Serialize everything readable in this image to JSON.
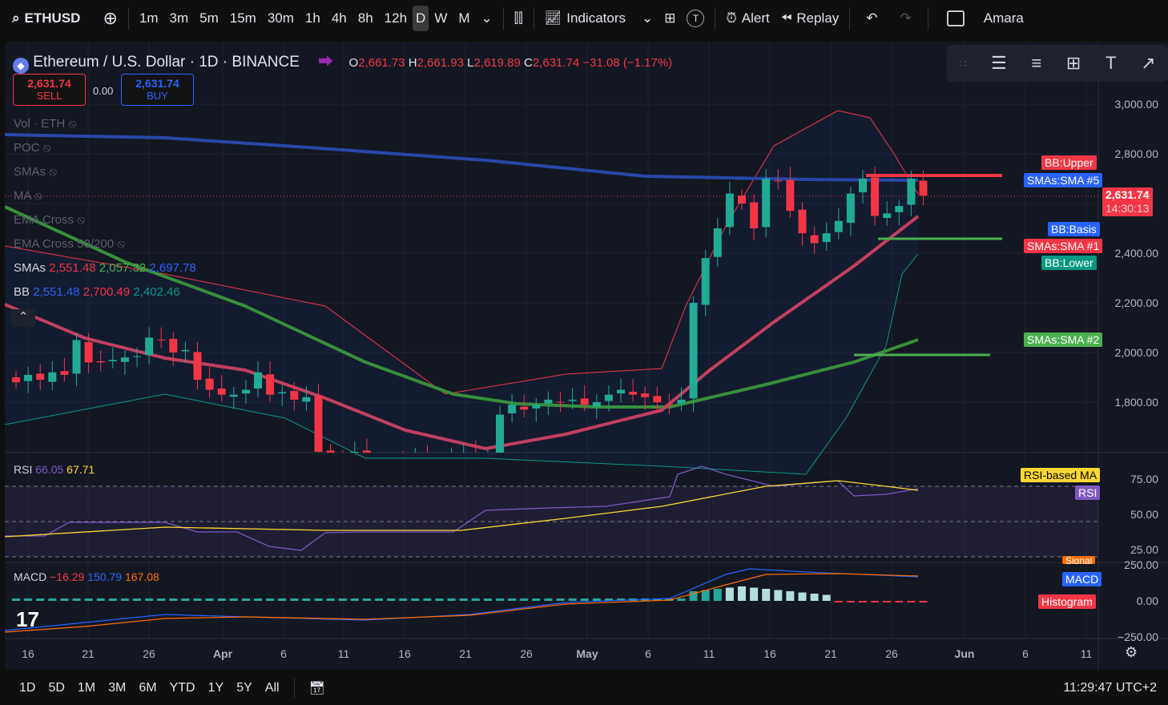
{
  "topbar": {
    "symbol": "ETHUSD",
    "intervals": [
      "1m",
      "3m",
      "5m",
      "15m",
      "30m",
      "1h",
      "4h",
      "8h",
      "12h",
      "D",
      "W",
      "M"
    ],
    "active_interval": "D",
    "indicators": "Indicators",
    "alert": "Alert",
    "replay": "Replay",
    "user": "Amara"
  },
  "header": {
    "title": "Ethereum / U.S. Dollar · 1D · BINANCE",
    "o_label": "O",
    "o": "2,661.73",
    "h_label": "H",
    "h": "2,661.93",
    "l_label": "L",
    "l": "2,619.89",
    "c_label": "C",
    "c": "2,631.74",
    "change": "−31.08 (−1.17%)"
  },
  "trade": {
    "sell_price": "2,631.74",
    "sell": "SELL",
    "spread": "0.00",
    "buy_price": "2,631.74",
    "buy": "BUY"
  },
  "legends": {
    "vol": "Vol · ETH",
    "poc": "POC",
    "smas_hidden": "SMAs",
    "ma": "MA",
    "ema": "EMA Cross",
    "ema2": "EMA Cross 50/200",
    "smas": "SMAs",
    "smas_v1": "2,551.48",
    "smas_v2": "2,057.32",
    "smas_v3": "2,697.78",
    "bb": "BB",
    "bb_v1": "2,551.48",
    "bb_v2": "2,700.49",
    "bb_v3": "2,402.46",
    "rsi": "RSI",
    "rsi_v1": "66.05",
    "rsi_v2": "67.71",
    "macd": "MACD",
    "macd_v1": "−16.29",
    "macd_v2": "150.79",
    "macd_v3": "167.08"
  },
  "price_axis": [
    "3,000.00",
    "2,800.00",
    "2,400.00",
    "2,200.00",
    "2,000.00",
    "1,800.00"
  ],
  "rsi_axis": [
    "75.00",
    "50.00",
    "25.00"
  ],
  "macd_axis": [
    "250.00",
    "0.00",
    "−250.00"
  ],
  "tags": {
    "bb_upper": "BB:Upper",
    "sma5": "SMAs:SMA #5",
    "last_price": "2,631.74",
    "countdown": "14:30:13",
    "bb_basis": "BB:Basis",
    "sma1": "SMAs:SMA #1",
    "bb_lower": "BB:Lower",
    "sma2": "SMAs:SMA #2",
    "rsi_ma": "RSI-based MA",
    "rsi": "RSI",
    "signal": "Signal",
    "macd": "MACD",
    "histogram": "Histogram"
  },
  "date_axis": [
    "16",
    "21",
    "26",
    "Apr",
    "6",
    "11",
    "16",
    "21",
    "26",
    "May",
    "6",
    "11",
    "16",
    "21",
    "26",
    "Jun",
    "6",
    "11"
  ],
  "bottombar": {
    "ranges": [
      "1D",
      "5D",
      "1M",
      "3M",
      "6M",
      "YTD",
      "1Y",
      "5Y",
      "All"
    ],
    "clock": "11:29:47 UTC+2"
  },
  "colors": {
    "up": "#22ab94",
    "down": "#f23645",
    "sma5": "#2962ff",
    "sma2": "#4caf50",
    "sma1": "#e0435c"
  },
  "chart_data": {
    "type": "candlestick",
    "start": "Mar 14",
    "closes": [
      1880,
      1910,
      1890,
      1920,
      1910,
      2050,
      1960,
      1960,
      1970,
      1980,
      1985,
      2060,
      2050,
      2000,
      2010,
      1890,
      1850,
      1830,
      1830,
      1850,
      1920,
      1830,
      1840,
      1810,
      1820,
      1600,
      1580,
      1540,
      1600,
      1560,
      1530,
      1560,
      1550,
      1570,
      1540,
      1560,
      1580,
      1590,
      1570,
      1580,
      1750,
      1790,
      1770,
      1790,
      1810,
      1800,
      1810,
      1790,
      1800,
      1830,
      1850,
      1830,
      1820,
      1800,
      1790,
      1810,
      2200,
      2380,
      2500,
      2640,
      2600,
      2500,
      2700,
      2690,
      2570,
      2480,
      2440,
      2480,
      2530,
      2640,
      2700,
      2550,
      2560,
      2590,
      2700,
      2631.74
    ]
  }
}
